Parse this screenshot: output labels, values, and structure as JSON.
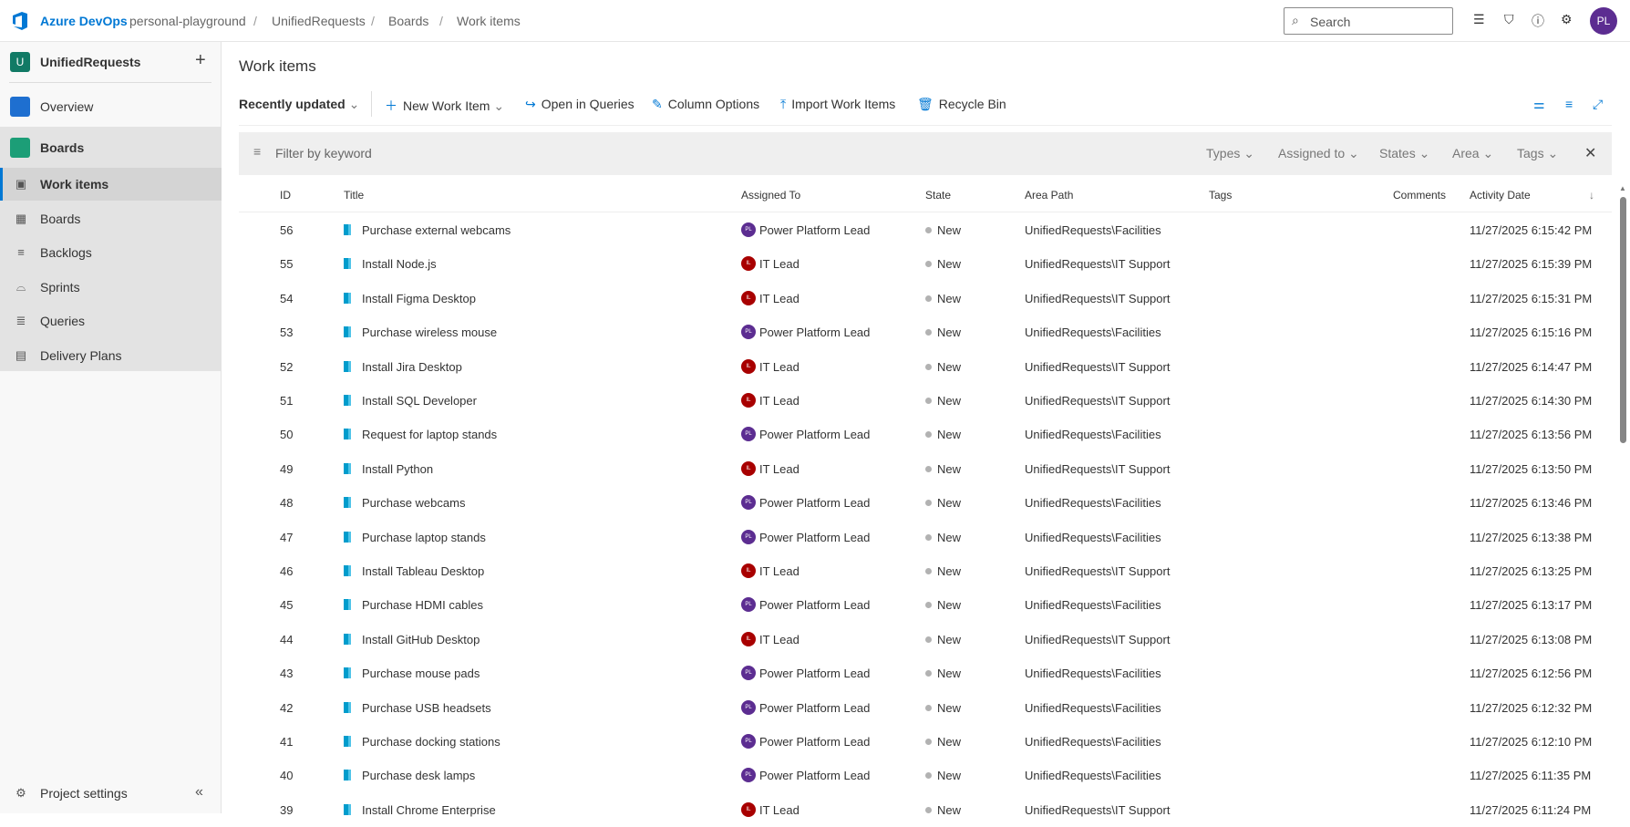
{
  "header": {
    "brand": "Azure DevOps",
    "breadcrumbs": [
      "personal-playground",
      "UnifiedRequests",
      "Boards",
      "Work items"
    ],
    "search_placeholder": "Search",
    "avatar_initials": "PL"
  },
  "sidebar": {
    "project_initial": "U",
    "project_name": "UnifiedRequests",
    "items": [
      {
        "label": "Overview"
      },
      {
        "label": "Boards"
      },
      {
        "label": "Work items"
      },
      {
        "label": "Boards"
      },
      {
        "label": "Backlogs"
      },
      {
        "label": "Sprints"
      },
      {
        "label": "Queries"
      },
      {
        "label": "Delivery Plans"
      }
    ],
    "settings": "Project settings"
  },
  "main": {
    "title": "Work items",
    "view": "Recently updated",
    "toolbar": [
      "New Work Item",
      "Open in Queries",
      "Column Options",
      "Import Work Items",
      "Recycle Bin"
    ],
    "filter": {
      "placeholder": "Filter by keyword",
      "dropdowns": [
        "Types",
        "Assigned to",
        "States",
        "Area",
        "Tags"
      ]
    },
    "columns": [
      "ID",
      "Title",
      "Assigned To",
      "State",
      "Area Path",
      "Tags",
      "Comments",
      "Activity Date"
    ],
    "colors": {
      "power": "#5c2d91",
      "it": "#a80000"
    },
    "rows": [
      [
        "56",
        "Purchase external webcams",
        "Power Platform Lead",
        "New",
        "UnifiedRequests\\Facilities",
        "11/27/2025 6:15:42 PM"
      ],
      [
        "55",
        "Install Node.js",
        "IT Lead",
        "New",
        "UnifiedRequests\\IT Support",
        "11/27/2025 6:15:39 PM"
      ],
      [
        "54",
        "Install Figma Desktop",
        "IT Lead",
        "New",
        "UnifiedRequests\\IT Support",
        "11/27/2025 6:15:31 PM"
      ],
      [
        "53",
        "Purchase wireless mouse",
        "Power Platform Lead",
        "New",
        "UnifiedRequests\\Facilities",
        "11/27/2025 6:15:16 PM"
      ],
      [
        "52",
        "Install Jira Desktop",
        "IT Lead",
        "New",
        "UnifiedRequests\\IT Support",
        "11/27/2025 6:14:47 PM"
      ],
      [
        "51",
        "Install SQL Developer",
        "IT Lead",
        "New",
        "UnifiedRequests\\IT Support",
        "11/27/2025 6:14:30 PM"
      ],
      [
        "50",
        "Request for laptop stands",
        "Power Platform Lead",
        "New",
        "UnifiedRequests\\Facilities",
        "11/27/2025 6:13:56 PM"
      ],
      [
        "49",
        "Install Python",
        "IT Lead",
        "New",
        "UnifiedRequests\\IT Support",
        "11/27/2025 6:13:50 PM"
      ],
      [
        "48",
        "Purchase webcams",
        "Power Platform Lead",
        "New",
        "UnifiedRequests\\Facilities",
        "11/27/2025 6:13:46 PM"
      ],
      [
        "47",
        "Purchase laptop stands",
        "Power Platform Lead",
        "New",
        "UnifiedRequests\\Facilities",
        "11/27/2025 6:13:38 PM"
      ],
      [
        "46",
        "Install Tableau Desktop",
        "IT Lead",
        "New",
        "UnifiedRequests\\IT Support",
        "11/27/2025 6:13:25 PM"
      ],
      [
        "45",
        "Purchase HDMI cables",
        "Power Platform Lead",
        "New",
        "UnifiedRequests\\Facilities",
        "11/27/2025 6:13:17 PM"
      ],
      [
        "44",
        "Install GitHub Desktop",
        "IT Lead",
        "New",
        "UnifiedRequests\\IT Support",
        "11/27/2025 6:13:08 PM"
      ],
      [
        "43",
        "Purchase mouse pads",
        "Power Platform Lead",
        "New",
        "UnifiedRequests\\Facilities",
        "11/27/2025 6:12:56 PM"
      ],
      [
        "42",
        "Purchase USB headsets",
        "Power Platform Lead",
        "New",
        "UnifiedRequests\\Facilities",
        "11/27/2025 6:12:32 PM"
      ],
      [
        "41",
        "Purchase docking stations",
        "Power Platform Lead",
        "New",
        "UnifiedRequests\\Facilities",
        "11/27/2025 6:12:10 PM"
      ],
      [
        "40",
        "Purchase desk lamps",
        "Power Platform Lead",
        "New",
        "UnifiedRequests\\Facilities",
        "11/27/2025 6:11:35 PM"
      ],
      [
        "39",
        "Install Chrome Enterprise",
        "IT Lead",
        "New",
        "UnifiedRequests\\IT Support",
        "11/27/2025 6:11:24 PM"
      ]
    ]
  }
}
